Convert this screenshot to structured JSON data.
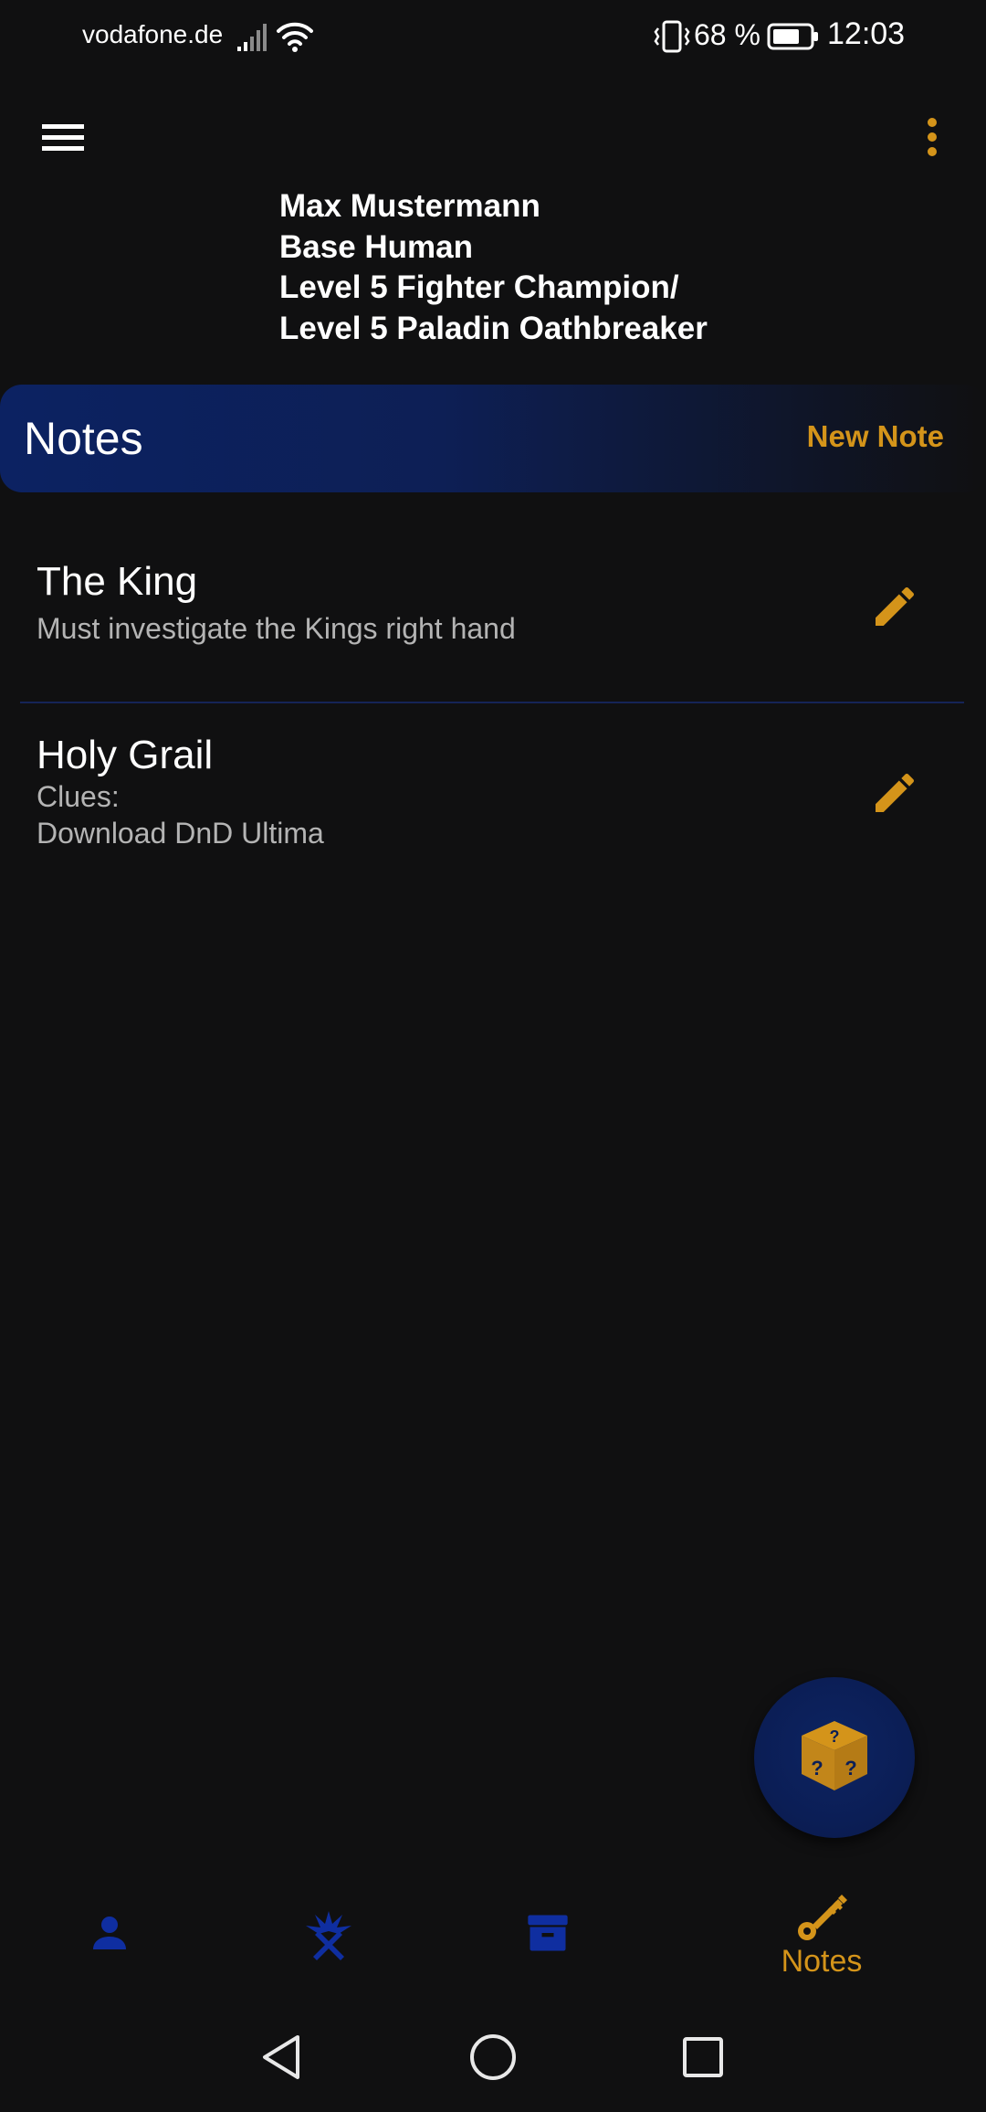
{
  "status_bar": {
    "carrier": "vodafone.de",
    "battery": "68 %",
    "time": "12:03"
  },
  "app_bar": {
    "menu_icon": "hamburger-menu-icon",
    "more_icon": "more-vert-icon"
  },
  "character": {
    "name": "Max Mustermann",
    "race": "Base Human",
    "class_line_1": "Level 5 Fighter Champion/",
    "class_line_2": "Level 5 Paladin Oathbreaker"
  },
  "notes_header": {
    "title": "Notes",
    "new_note_label": "New Note"
  },
  "notes": [
    {
      "title": "The King",
      "body": "Must investigate the Kings right hand"
    },
    {
      "title": "Holy Grail",
      "body": "Clues:\nDownload DnD Ultima"
    }
  ],
  "fab": {
    "icon": "dice-icon"
  },
  "bottom_nav": {
    "items": [
      {
        "icon": "person-icon",
        "label": ""
      },
      {
        "icon": "spells-icon",
        "label": ""
      },
      {
        "icon": "inventory-box-icon",
        "label": ""
      },
      {
        "icon": "key-icon",
        "label": "Notes"
      }
    ],
    "active_color": "#d4941a",
    "inactive_color": "#0f2ea0"
  },
  "colors": {
    "background": "#101011",
    "accent": "#d4941a",
    "primary": "#0c2262"
  }
}
